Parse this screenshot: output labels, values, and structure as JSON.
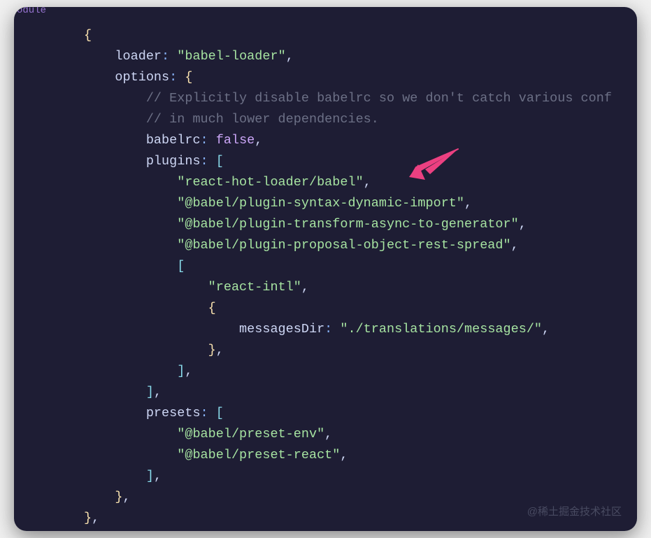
{
  "top_cut": "odule",
  "code": {
    "loader_key": "loader",
    "loader_val": "\"babel-loader\"",
    "options_key": "options",
    "comment1": "// Explicitly disable babelrc so we don't catch various conf",
    "comment2": "// in much lower dependencies.",
    "babelrc_key": "babelrc",
    "babelrc_val": "false",
    "plugins_key": "plugins",
    "plugin1": "\"react-hot-loader/babel\"",
    "plugin2": "\"@babel/plugin-syntax-dynamic-import\"",
    "plugin3": "\"@babel/plugin-transform-async-to-generator\"",
    "plugin4": "\"@babel/plugin-proposal-object-rest-spread\"",
    "subplugin": "\"react-intl\"",
    "msg_key": "messagesDir",
    "msg_val": "\"./translations/messages/\"",
    "presets_key": "presets",
    "preset1": "\"@babel/preset-env\"",
    "preset2": "\"@babel/preset-react\""
  },
  "watermark": "@稀土掘金技术社区",
  "colors": {
    "bg": "#1e1d34",
    "brace": "#f9e2af",
    "bracket": "#89dceb",
    "string": "#a6e3a1",
    "comment": "#6c7086",
    "keyword": "#cba6f7",
    "arrow": "#ec4081"
  }
}
